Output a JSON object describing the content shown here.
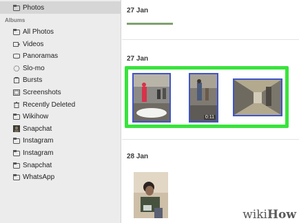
{
  "sidebar": {
    "top_item": "Photos",
    "section_label": "Albums",
    "items": [
      {
        "label": "All Photos",
        "icon": "folder-icon"
      },
      {
        "label": "Videos",
        "icon": "video-icon"
      },
      {
        "label": "Panoramas",
        "icon": "panorama-icon"
      },
      {
        "label": "Slo-mo",
        "icon": "slomo-icon"
      },
      {
        "label": "Bursts",
        "icon": "bursts-icon"
      },
      {
        "label": "Screenshots",
        "icon": "screenshot-icon"
      },
      {
        "label": "Recently Deleted",
        "icon": "trash-icon"
      },
      {
        "label": "Wikihow",
        "icon": "folder-icon"
      },
      {
        "label": "Snapchat",
        "icon": "snapchat-thumb-icon"
      },
      {
        "label": "Instagram",
        "icon": "folder-icon"
      },
      {
        "label": "Instagram",
        "icon": "folder-icon"
      },
      {
        "label": "Snapchat",
        "icon": "folder-icon"
      },
      {
        "label": "WhatsApp",
        "icon": "folder-icon"
      }
    ]
  },
  "main": {
    "days": [
      {
        "title": "27 Jan"
      },
      {
        "title": "27 Jan",
        "video_duration": "0:11"
      },
      {
        "title": "28 Jan"
      }
    ]
  },
  "colors": {
    "selection_highlight": "#37e43b",
    "thumb_border": "#3f55c7",
    "sidebar_bg": "#ececec"
  },
  "watermark": {
    "wiki": "wiki",
    "how": "How"
  }
}
